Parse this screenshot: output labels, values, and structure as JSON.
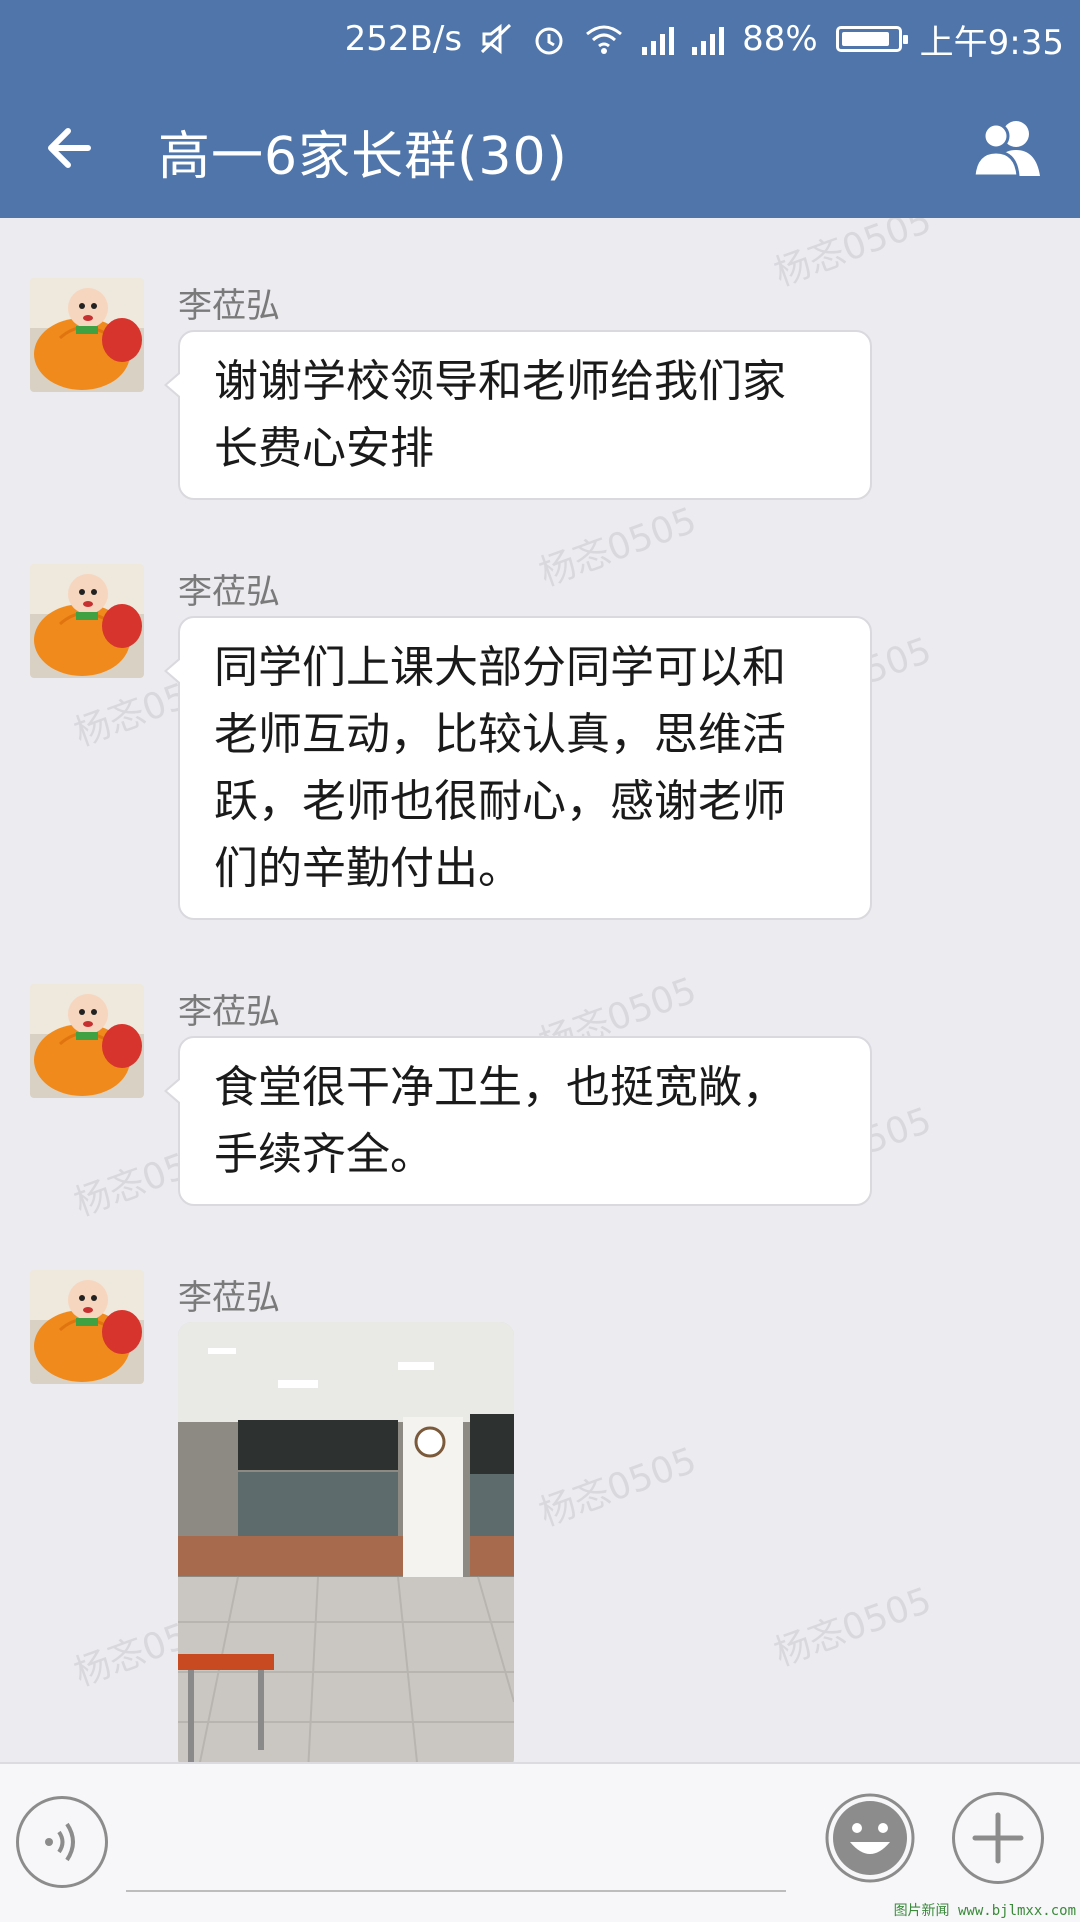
{
  "status_bar": {
    "net_speed": "252B/s",
    "battery": "88%",
    "battery_level": 0.88,
    "time": "上午9:35",
    "icons": [
      "mute-icon",
      "alarm-icon",
      "wifi-icon",
      "signal-icon",
      "signal-icon",
      "battery-icon"
    ]
  },
  "header": {
    "title": "高一6家长群(30)",
    "back_icon": "back-arrow-icon",
    "members_icon": "group-members-icon",
    "bg_color": "#4f75aa"
  },
  "messages": [
    {
      "sender": "李莅弘",
      "type": "text",
      "lines": [
        "谢谢学校领导和老师给我们家",
        "长费心安排"
      ]
    },
    {
      "sender": "李莅弘",
      "type": "text",
      "lines": [
        "同学们上课大部分同学可以和",
        "老师互动，比较认真，思维活",
        "跃，老师也很耐心，感谢老师",
        "们的辛勤付出。"
      ]
    },
    {
      "sender": "李莅弘",
      "type": "text",
      "lines": [
        "食堂很干净卫生，也挺宽敞，",
        "手续齐全。"
      ]
    },
    {
      "sender": "李莅弘",
      "type": "image"
    }
  ],
  "watermark": "杨忞0505",
  "input_bar": {
    "voice_icon": "voice-icon",
    "emoji_icon": "emoji-icon",
    "plus_icon": "plus-icon"
  },
  "footer_logo": "图片新闻 www.bjlmxx.com"
}
